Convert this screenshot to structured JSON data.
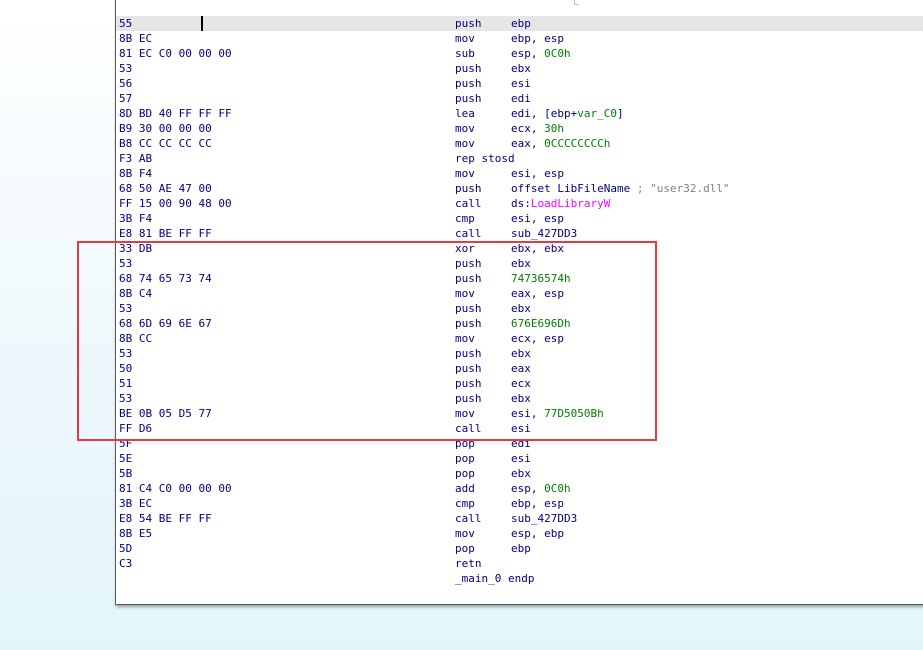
{
  "disassembly": {
    "lines": [
      {
        "bytes": "55",
        "mnemonic": "push",
        "operands": [
          {
            "t": "ebp"
          }
        ]
      },
      {
        "bytes": "8B EC",
        "mnemonic": "mov",
        "operands": [
          {
            "t": "ebp, esp"
          }
        ]
      },
      {
        "bytes": "81 EC C0 00 00 00",
        "mnemonic": "sub",
        "operands": [
          {
            "t": "esp, "
          },
          {
            "t": "0C0h",
            "c": "num"
          }
        ]
      },
      {
        "bytes": "53",
        "mnemonic": "push",
        "operands": [
          {
            "t": "ebx"
          }
        ]
      },
      {
        "bytes": "56",
        "mnemonic": "push",
        "operands": [
          {
            "t": "esi"
          }
        ]
      },
      {
        "bytes": "57",
        "mnemonic": "push",
        "operands": [
          {
            "t": "edi"
          }
        ]
      },
      {
        "bytes": "8D BD 40 FF FF FF",
        "mnemonic": "lea",
        "operands": [
          {
            "t": "edi, [ebp+"
          },
          {
            "t": "var_C0",
            "c": "num"
          },
          {
            "t": "]"
          }
        ]
      },
      {
        "bytes": "B9 30 00 00 00",
        "mnemonic": "mov",
        "operands": [
          {
            "t": "ecx, "
          },
          {
            "t": "30h",
            "c": "num"
          }
        ]
      },
      {
        "bytes": "B8 CC CC CC CC",
        "mnemonic": "mov",
        "operands": [
          {
            "t": "eax, "
          },
          {
            "t": "0CCCCCCCCh",
            "c": "num"
          }
        ]
      },
      {
        "bytes": "F3 AB",
        "mnemonic": "rep stosd",
        "operands": []
      },
      {
        "bytes": "8B F4",
        "mnemonic": "mov",
        "operands": [
          {
            "t": "esi, esp"
          }
        ]
      },
      {
        "bytes": "68 50 AE 47 00",
        "mnemonic": "push",
        "operands": [
          {
            "t": "offset LibFileName "
          },
          {
            "t": "; \"user32.dll\"",
            "c": "cmt"
          }
        ]
      },
      {
        "bytes": "FF 15 00 90 48 00",
        "mnemonic": "call",
        "operands": [
          {
            "t": "ds:"
          },
          {
            "t": "LoadLibraryW",
            "c": "imp"
          }
        ]
      },
      {
        "bytes": "3B F4",
        "mnemonic": "cmp",
        "operands": [
          {
            "t": "esi, esp"
          }
        ]
      },
      {
        "bytes": "E8 81 BE FF FF",
        "mnemonic": "call",
        "operands": [
          {
            "t": "sub_427DD3"
          }
        ]
      },
      {
        "bytes": "33 DB",
        "mnemonic": "xor",
        "operands": [
          {
            "t": "ebx, ebx"
          }
        ]
      },
      {
        "bytes": "53",
        "mnemonic": "push",
        "operands": [
          {
            "t": "ebx"
          }
        ]
      },
      {
        "bytes": "68 74 65 73 74",
        "mnemonic": "push",
        "operands": [
          {
            "t": "74736574h",
            "c": "num"
          }
        ]
      },
      {
        "bytes": "8B C4",
        "mnemonic": "mov",
        "operands": [
          {
            "t": "eax, esp"
          }
        ]
      },
      {
        "bytes": "53",
        "mnemonic": "push",
        "operands": [
          {
            "t": "ebx"
          }
        ]
      },
      {
        "bytes": "68 6D 69 6E 67",
        "mnemonic": "push",
        "operands": [
          {
            "t": "676E696Dh",
            "c": "num"
          }
        ]
      },
      {
        "bytes": "8B CC",
        "mnemonic": "mov",
        "operands": [
          {
            "t": "ecx, esp"
          }
        ]
      },
      {
        "bytes": "53",
        "mnemonic": "push",
        "operands": [
          {
            "t": "ebx"
          }
        ]
      },
      {
        "bytes": "50",
        "mnemonic": "push",
        "operands": [
          {
            "t": "eax"
          }
        ]
      },
      {
        "bytes": "51",
        "mnemonic": "push",
        "operands": [
          {
            "t": "ecx"
          }
        ]
      },
      {
        "bytes": "53",
        "mnemonic": "push",
        "operands": [
          {
            "t": "ebx"
          }
        ]
      },
      {
        "bytes": "BE 0B 05 D5 77",
        "mnemonic": "mov",
        "operands": [
          {
            "t": "esi, "
          },
          {
            "t": "77D5050Bh",
            "c": "num"
          }
        ]
      },
      {
        "bytes": "FF D6",
        "mnemonic": "call",
        "operands": [
          {
            "t": "esi"
          }
        ]
      },
      {
        "bytes": "5F",
        "mnemonic": "pop",
        "operands": [
          {
            "t": "edi"
          }
        ]
      },
      {
        "bytes": "5E",
        "mnemonic": "pop",
        "operands": [
          {
            "t": "esi"
          }
        ]
      },
      {
        "bytes": "5B",
        "mnemonic": "pop",
        "operands": [
          {
            "t": "ebx"
          }
        ]
      },
      {
        "bytes": "81 C4 C0 00 00 00",
        "mnemonic": "add",
        "operands": [
          {
            "t": "esp, "
          },
          {
            "t": "0C0h",
            "c": "num"
          }
        ]
      },
      {
        "bytes": "3B EC",
        "mnemonic": "cmp",
        "operands": [
          {
            "t": "ebp, esp"
          }
        ]
      },
      {
        "bytes": "E8 54 BE FF FF",
        "mnemonic": "call",
        "operands": [
          {
            "t": "sub_427DD3"
          }
        ]
      },
      {
        "bytes": "8B E5",
        "mnemonic": "mov",
        "operands": [
          {
            "t": "esp, ebp"
          }
        ]
      },
      {
        "bytes": "5D",
        "mnemonic": "pop",
        "operands": [
          {
            "t": "ebp"
          }
        ]
      },
      {
        "bytes": "C3",
        "mnemonic": "retn",
        "operands": []
      },
      {
        "bytes": "",
        "mnemonic": "_main_0 endp",
        "operands": []
      }
    ],
    "highlighted_line": 0,
    "selection_box": {
      "first_line": 15,
      "last_line": 27,
      "color": "#e8393f"
    }
  },
  "colors": {
    "text": "#000080",
    "number": "#008000",
    "import": "#ff00ff",
    "comment": "#808080",
    "line_highlight": "#e6e6e6"
  }
}
